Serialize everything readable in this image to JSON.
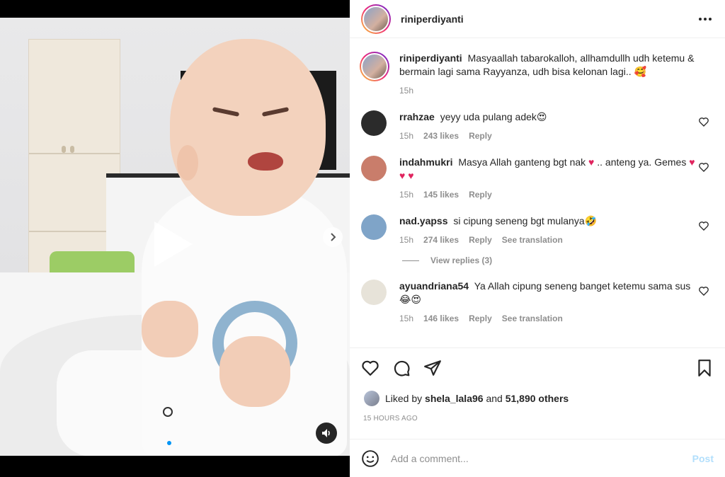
{
  "post": {
    "username": "riniperdiyanti",
    "more_icon": "more-horizontal-icon"
  },
  "caption": {
    "username": "riniperdiyanti",
    "text": "Masyaallah tabarokalloh, allhamdullh udh ketemu & bermain lagi sama Rayyanza, udh bisa kelonan lagi.. 🥰",
    "time": "15h"
  },
  "comments": [
    {
      "username": "rrahzae",
      "text": "yeyy uda pulang adek😍",
      "time": "15h",
      "likes": "243 likes",
      "reply": "Reply",
      "avatar_color": "#2b2b2b"
    },
    {
      "username": "indahmukri",
      "text_pre": "Masya Allah ganteng bgt nak ",
      "heart1": "♥",
      "text_mid": " .. anteng ya. Gemes ",
      "hearts": "♥ ♥ ♥",
      "time": "15h",
      "likes": "145 likes",
      "reply": "Reply",
      "avatar_color": "#c97d6b"
    },
    {
      "username": "nad.yapss",
      "text": "si cipung seneng bgt mulanya🤣",
      "time": "15h",
      "likes": "274 likes",
      "reply": "Reply",
      "translation": "See translation",
      "avatar_color": "#7fa4c8"
    },
    {
      "username": "ayuandriana54",
      "text": "Ya Allah cipung seneng banget ketemu sama sus😂😍",
      "time": "15h",
      "likes": "146 likes",
      "reply": "Reply",
      "translation": "See translation",
      "avatar_color": "#e7e3d9"
    }
  ],
  "view_replies": "View replies (3)",
  "likes": {
    "prefix": "Liked by",
    "user": "shela_lala96",
    "joiner": "and",
    "others": "51,890 others"
  },
  "timestamp": "15 HOURS AGO",
  "add_comment": {
    "placeholder": "Add a comment...",
    "post_label": "Post"
  },
  "colors": {
    "accent": "#0095f6",
    "post_disabled": "#b2dffc",
    "heart_red": "#e0245e"
  }
}
